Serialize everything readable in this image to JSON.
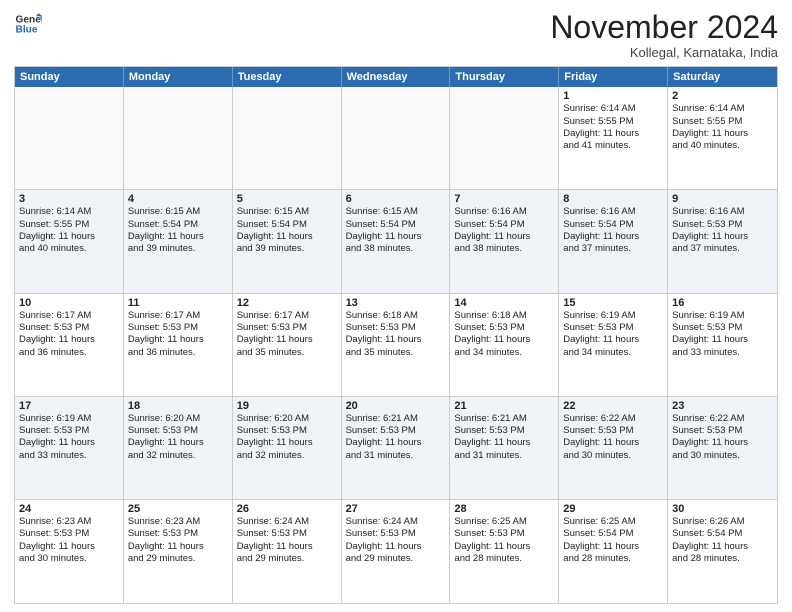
{
  "logo": {
    "line1": "General",
    "line2": "Blue"
  },
  "title": "November 2024",
  "location": "Kollegal, Karnataka, India",
  "weekdays": [
    "Sunday",
    "Monday",
    "Tuesday",
    "Wednesday",
    "Thursday",
    "Friday",
    "Saturday"
  ],
  "rows": [
    [
      {
        "day": "",
        "lines": [],
        "empty": true
      },
      {
        "day": "",
        "lines": [],
        "empty": true
      },
      {
        "day": "",
        "lines": [],
        "empty": true
      },
      {
        "day": "",
        "lines": [],
        "empty": true
      },
      {
        "day": "",
        "lines": [],
        "empty": true
      },
      {
        "day": "1",
        "lines": [
          "Sunrise: 6:14 AM",
          "Sunset: 5:55 PM",
          "Daylight: 11 hours",
          "and 41 minutes."
        ],
        "empty": false
      },
      {
        "day": "2",
        "lines": [
          "Sunrise: 6:14 AM",
          "Sunset: 5:55 PM",
          "Daylight: 11 hours",
          "and 40 minutes."
        ],
        "empty": false
      }
    ],
    [
      {
        "day": "3",
        "lines": [
          "Sunrise: 6:14 AM",
          "Sunset: 5:55 PM",
          "Daylight: 11 hours",
          "and 40 minutes."
        ],
        "empty": false
      },
      {
        "day": "4",
        "lines": [
          "Sunrise: 6:15 AM",
          "Sunset: 5:54 PM",
          "Daylight: 11 hours",
          "and 39 minutes."
        ],
        "empty": false
      },
      {
        "day": "5",
        "lines": [
          "Sunrise: 6:15 AM",
          "Sunset: 5:54 PM",
          "Daylight: 11 hours",
          "and 39 minutes."
        ],
        "empty": false
      },
      {
        "day": "6",
        "lines": [
          "Sunrise: 6:15 AM",
          "Sunset: 5:54 PM",
          "Daylight: 11 hours",
          "and 38 minutes."
        ],
        "empty": false
      },
      {
        "day": "7",
        "lines": [
          "Sunrise: 6:16 AM",
          "Sunset: 5:54 PM",
          "Daylight: 11 hours",
          "and 38 minutes."
        ],
        "empty": false
      },
      {
        "day": "8",
        "lines": [
          "Sunrise: 6:16 AM",
          "Sunset: 5:54 PM",
          "Daylight: 11 hours",
          "and 37 minutes."
        ],
        "empty": false
      },
      {
        "day": "9",
        "lines": [
          "Sunrise: 6:16 AM",
          "Sunset: 5:53 PM",
          "Daylight: 11 hours",
          "and 37 minutes."
        ],
        "empty": false
      }
    ],
    [
      {
        "day": "10",
        "lines": [
          "Sunrise: 6:17 AM",
          "Sunset: 5:53 PM",
          "Daylight: 11 hours",
          "and 36 minutes."
        ],
        "empty": false
      },
      {
        "day": "11",
        "lines": [
          "Sunrise: 6:17 AM",
          "Sunset: 5:53 PM",
          "Daylight: 11 hours",
          "and 36 minutes."
        ],
        "empty": false
      },
      {
        "day": "12",
        "lines": [
          "Sunrise: 6:17 AM",
          "Sunset: 5:53 PM",
          "Daylight: 11 hours",
          "and 35 minutes."
        ],
        "empty": false
      },
      {
        "day": "13",
        "lines": [
          "Sunrise: 6:18 AM",
          "Sunset: 5:53 PM",
          "Daylight: 11 hours",
          "and 35 minutes."
        ],
        "empty": false
      },
      {
        "day": "14",
        "lines": [
          "Sunrise: 6:18 AM",
          "Sunset: 5:53 PM",
          "Daylight: 11 hours",
          "and 34 minutes."
        ],
        "empty": false
      },
      {
        "day": "15",
        "lines": [
          "Sunrise: 6:19 AM",
          "Sunset: 5:53 PM",
          "Daylight: 11 hours",
          "and 34 minutes."
        ],
        "empty": false
      },
      {
        "day": "16",
        "lines": [
          "Sunrise: 6:19 AM",
          "Sunset: 5:53 PM",
          "Daylight: 11 hours",
          "and 33 minutes."
        ],
        "empty": false
      }
    ],
    [
      {
        "day": "17",
        "lines": [
          "Sunrise: 6:19 AM",
          "Sunset: 5:53 PM",
          "Daylight: 11 hours",
          "and 33 minutes."
        ],
        "empty": false
      },
      {
        "day": "18",
        "lines": [
          "Sunrise: 6:20 AM",
          "Sunset: 5:53 PM",
          "Daylight: 11 hours",
          "and 32 minutes."
        ],
        "empty": false
      },
      {
        "day": "19",
        "lines": [
          "Sunrise: 6:20 AM",
          "Sunset: 5:53 PM",
          "Daylight: 11 hours",
          "and 32 minutes."
        ],
        "empty": false
      },
      {
        "day": "20",
        "lines": [
          "Sunrise: 6:21 AM",
          "Sunset: 5:53 PM",
          "Daylight: 11 hours",
          "and 31 minutes."
        ],
        "empty": false
      },
      {
        "day": "21",
        "lines": [
          "Sunrise: 6:21 AM",
          "Sunset: 5:53 PM",
          "Daylight: 11 hours",
          "and 31 minutes."
        ],
        "empty": false
      },
      {
        "day": "22",
        "lines": [
          "Sunrise: 6:22 AM",
          "Sunset: 5:53 PM",
          "Daylight: 11 hours",
          "and 30 minutes."
        ],
        "empty": false
      },
      {
        "day": "23",
        "lines": [
          "Sunrise: 6:22 AM",
          "Sunset: 5:53 PM",
          "Daylight: 11 hours",
          "and 30 minutes."
        ],
        "empty": false
      }
    ],
    [
      {
        "day": "24",
        "lines": [
          "Sunrise: 6:23 AM",
          "Sunset: 5:53 PM",
          "Daylight: 11 hours",
          "and 30 minutes."
        ],
        "empty": false
      },
      {
        "day": "25",
        "lines": [
          "Sunrise: 6:23 AM",
          "Sunset: 5:53 PM",
          "Daylight: 11 hours",
          "and 29 minutes."
        ],
        "empty": false
      },
      {
        "day": "26",
        "lines": [
          "Sunrise: 6:24 AM",
          "Sunset: 5:53 PM",
          "Daylight: 11 hours",
          "and 29 minutes."
        ],
        "empty": false
      },
      {
        "day": "27",
        "lines": [
          "Sunrise: 6:24 AM",
          "Sunset: 5:53 PM",
          "Daylight: 11 hours",
          "and 29 minutes."
        ],
        "empty": false
      },
      {
        "day": "28",
        "lines": [
          "Sunrise: 6:25 AM",
          "Sunset: 5:53 PM",
          "Daylight: 11 hours",
          "and 28 minutes."
        ],
        "empty": false
      },
      {
        "day": "29",
        "lines": [
          "Sunrise: 6:25 AM",
          "Sunset: 5:54 PM",
          "Daylight: 11 hours",
          "and 28 minutes."
        ],
        "empty": false
      },
      {
        "day": "30",
        "lines": [
          "Sunrise: 6:26 AM",
          "Sunset: 5:54 PM",
          "Daylight: 11 hours",
          "and 28 minutes."
        ],
        "empty": false
      }
    ]
  ]
}
